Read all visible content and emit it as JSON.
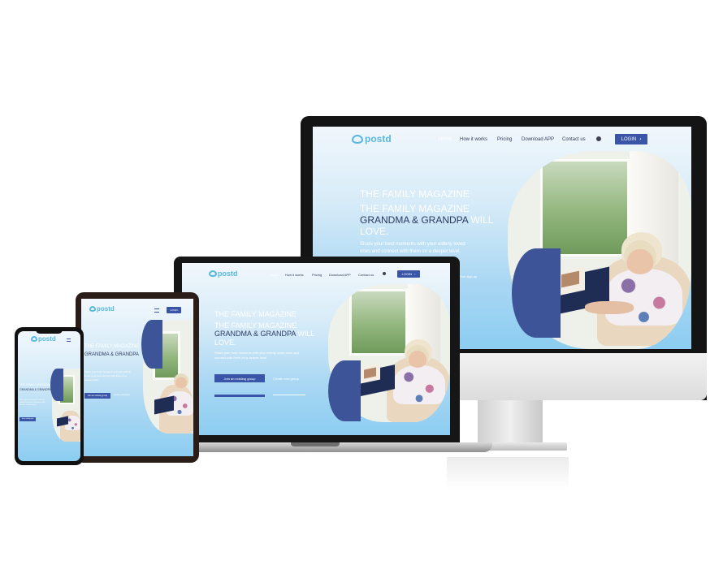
{
  "brand": {
    "logo_text": "postd",
    "tagline": "FAMILY MAGAZINE"
  },
  "nav": {
    "home": "Home",
    "how_it_works": "How it works",
    "pricing": "Pricing",
    "download_app": "Download APP",
    "contact_us": "Contact us",
    "login": "LOGIN",
    "login_arrow": "›"
  },
  "hero": {
    "line1": "THE FAMILY MAGAZINE",
    "line2_prefix": "THE FAMILY MAGAZINE",
    "line3_dark": "GRANDMA & GRANDPA",
    "line3_light": " WILL",
    "line4": "LOVE.",
    "paragraph": "Share your best moments with your elderly loved ones and connect with them on a deeper level.",
    "cta_join": "Join an existing group",
    "cta_create": "Create new group",
    "cta_signup": "Free sign up"
  },
  "phone": {
    "line1": "THE FAMILY MAGAZINE",
    "line2": "GRANDMA & GRANDPA WILL"
  },
  "colors": {
    "accent": "#3a55a8",
    "logo": "#5ab7de",
    "heading_dark": "#2b3a62",
    "screen_bottom": "#8ccdf1"
  }
}
